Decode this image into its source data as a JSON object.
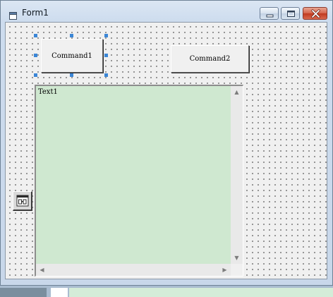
{
  "window": {
    "title": "Form1",
    "icon": "form-icon",
    "controls": [
      "minimize-icon",
      "maximize-icon",
      "close-icon"
    ]
  },
  "form": {
    "command1_label": "Command1",
    "command2_label": "Command2",
    "text1_value": "Text1",
    "timer_icon": "timer-control-icon",
    "colors": {
      "textbox_background": "#cfe8d0",
      "selection_handles": "#3b86d6",
      "close_button": "#c0391f"
    }
  }
}
